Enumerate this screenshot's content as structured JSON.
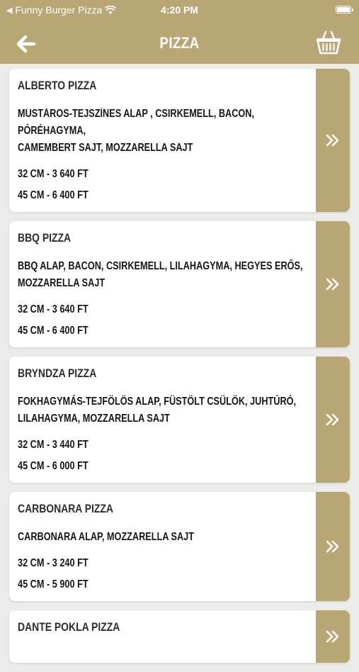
{
  "status": {
    "carrier": "Funny Burger Pizza",
    "time": "4:20 PM"
  },
  "header": {
    "title": "PIZZA"
  },
  "colors": {
    "accent": "#b8a674",
    "background": "#ecebe9"
  },
  "items": [
    {
      "name": "ALBERTO PIZZA",
      "desc_lines": [
        "MUSTÁROS-TEJSZÍNES ALAP , CSIRKEMELL, BACON, PÓRÉHAGYMA,",
        "CAMEMBERT SAJT, MOZZARELLA SAJT"
      ],
      "prices": [
        "32 CM - 3 640 FT",
        "45 CM - 6 400 FT"
      ]
    },
    {
      "name": "BBQ PIZZA",
      "desc_lines": [
        "BBQ ALAP, BACON, CSIRKEMELL, LILAHAGYMA, HEGYES ERŐS,",
        "MOZZARELLA SAJT"
      ],
      "prices": [
        "32 CM - 3 640 FT",
        "45 CM - 6 400 FT"
      ]
    },
    {
      "name": "BRYNDZA PIZZA",
      "desc_lines": [
        "FOKHAGYMÁS-TEJFÖLÖS ALAP, FÜSTÖLT CSÜLÖK, JUHTÚRÓ,",
        "LILAHAGYMA, MOZZARELLA SAJT"
      ],
      "prices": [
        "32 CM - 3 440 FT",
        "45 CM - 6 000 FT"
      ]
    },
    {
      "name": "CARBONARA PIZZA",
      "desc_lines": [
        "CARBONARA ALAP, MOZZARELLA SAJT"
      ],
      "prices": [
        "32 CM - 3 240 FT",
        "45 CM - 5 900 FT"
      ]
    },
    {
      "name": "DANTE POKLA PIZZA",
      "desc_lines": [],
      "prices": []
    }
  ]
}
